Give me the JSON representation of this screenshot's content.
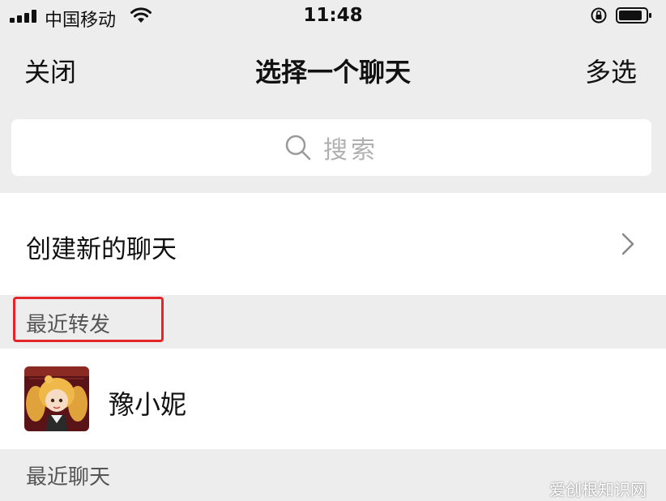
{
  "status_bar": {
    "carrier": "中国移动",
    "time": "11:48"
  },
  "nav": {
    "close_label": "关闭",
    "title": "选择一个聊天",
    "multi_select_label": "多选"
  },
  "search": {
    "placeholder": "搜索"
  },
  "new_chat": {
    "label": "创建新的聊天"
  },
  "sections": {
    "recent_forward": "最近转发",
    "recent_chats": "最近聊天"
  },
  "recent_forward_contacts": [
    {
      "name": "豫小妮"
    }
  ],
  "watermark": "爱创根知识网",
  "colors": {
    "background": "#ededed",
    "row_background": "#ffffff",
    "highlight_border": "#e4262a"
  },
  "icons": {
    "signal": "signal-bars-icon",
    "wifi": "wifi-icon",
    "rotation_lock": "rotation-lock-icon",
    "battery": "battery-icon",
    "search": "search-icon",
    "chevron": "chevron-right-icon"
  }
}
